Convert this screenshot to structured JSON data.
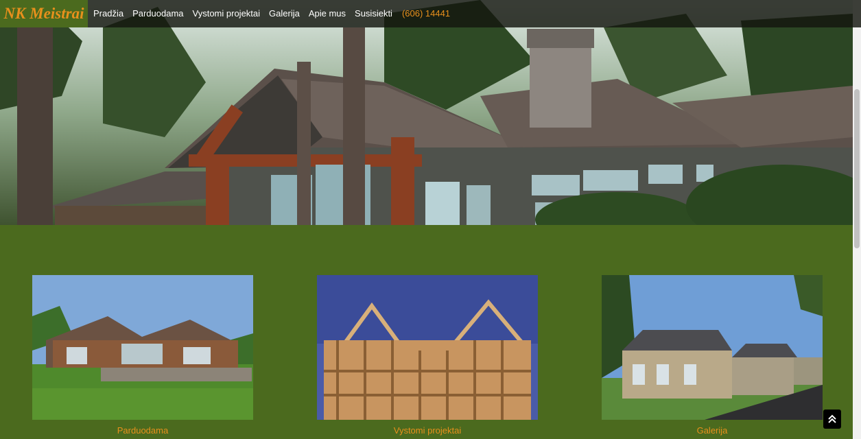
{
  "brand": "NK Meistrai",
  "nav": {
    "items": [
      "Pradžia",
      "Parduodama",
      "Vystomi projektai",
      "Galerija",
      "Apie mus",
      "Susisiekti"
    ],
    "phone": "(606) 14441"
  },
  "cards": [
    {
      "label": "Parduodama"
    },
    {
      "label": "Vystomi projektai"
    },
    {
      "label": "Galerija"
    }
  ],
  "colors": {
    "background": "#4b6a1e",
    "accent": "#e8901c",
    "navbar": "#14160f"
  },
  "icons": {
    "back_to_top": "double-chevron-up-icon"
  }
}
